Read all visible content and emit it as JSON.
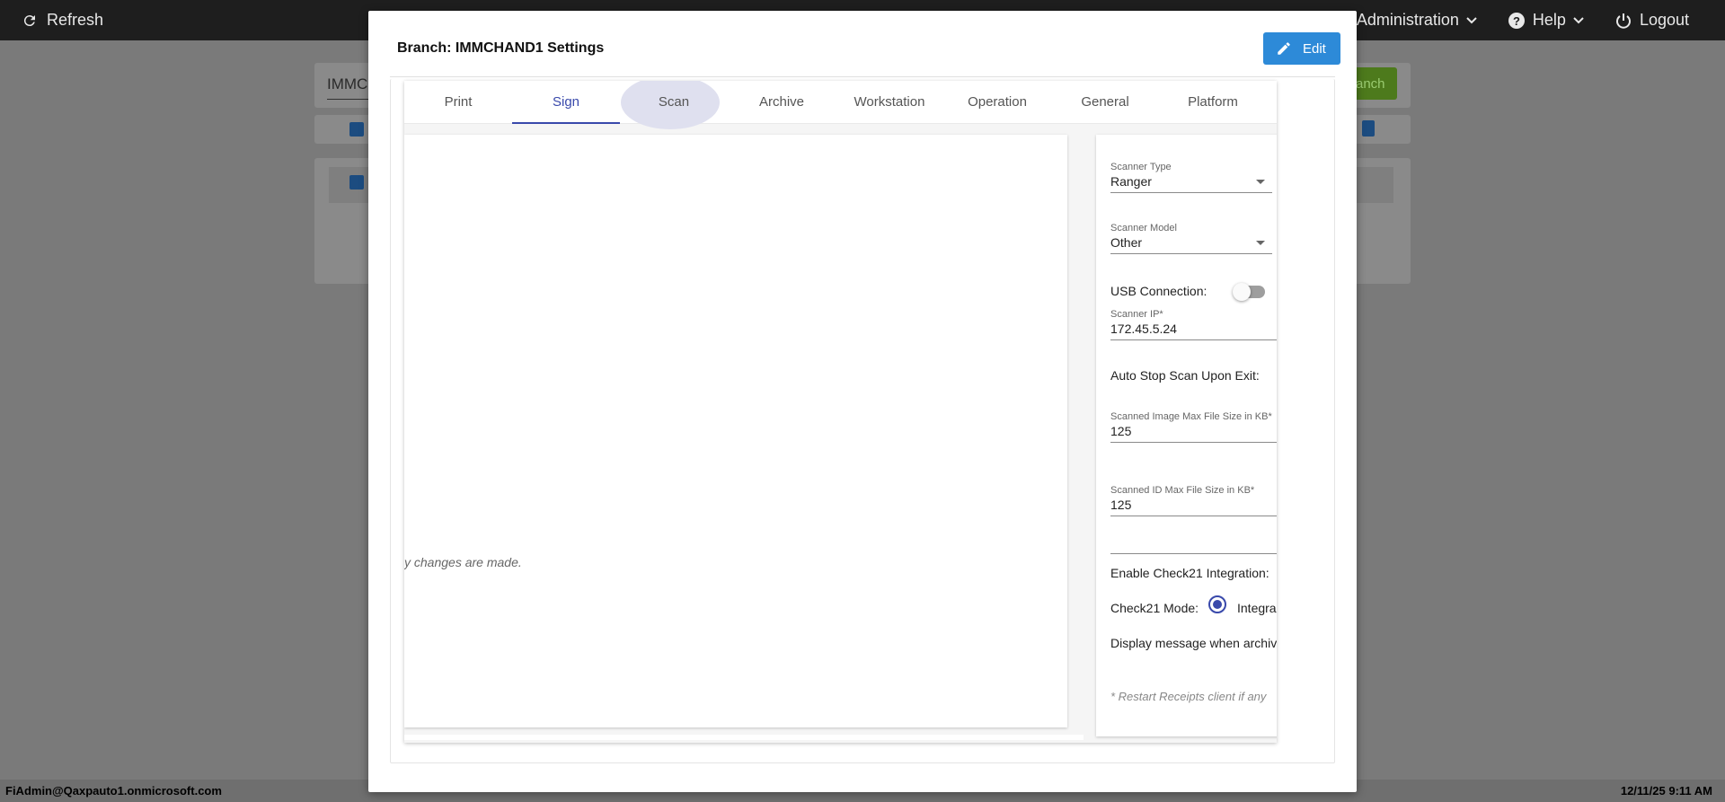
{
  "topbar": {
    "refresh_label": "Refresh",
    "menu": [
      {
        "label": "Administration"
      },
      {
        "label": "Help"
      },
      {
        "label": "Logout"
      }
    ]
  },
  "background": {
    "search_text": "IMMCI",
    "search_button": "anch"
  },
  "status_bar": {
    "user": "FiAdmin@Qaxpauto1.onmicrosoft.com",
    "datetime": "12/11/25 9:11 AM"
  },
  "modal": {
    "title": "Branch: IMMCHAND1 Settings",
    "edit_label": "Edit",
    "tabs": [
      {
        "label": "Print"
      },
      {
        "label": "Sign"
      },
      {
        "label": "Scan"
      },
      {
        "label": "Archive"
      },
      {
        "label": "Workstation"
      },
      {
        "label": "Operation"
      },
      {
        "label": "General"
      },
      {
        "label": "Platform"
      }
    ],
    "active_tab": "Sign",
    "left_note": "y changes are made.",
    "scan": {
      "scanner_type_label": "Scanner Type",
      "scanner_type_value": "Ranger",
      "scanner_model_label": "Scanner Model",
      "scanner_model_value": "Other",
      "usb_label": "USB Connection:",
      "usb_enabled": false,
      "scanner_ip_label": "Scanner IP*",
      "scanner_ip_value": "172.45.5.24",
      "auto_stop_label": "Auto Stop Scan Upon Exit:",
      "image_size_label": "Scanned Image Max File Size in KB*",
      "image_size_value": "125",
      "id_size_label": "Scanned ID Max File Size in KB*",
      "id_size_value": "125",
      "check21_label": "Enable Check21 Integration:",
      "check21_mode_label": "Check21 Mode:",
      "check21_mode_value": "Integra",
      "display_msg_label": "Display message when archiv",
      "restart_note": "* Restart Receipts client if any"
    }
  },
  "colors": {
    "accent": "#3949ab",
    "edit_button": "#2d8ad8",
    "topbar": "#1e1e1e"
  }
}
